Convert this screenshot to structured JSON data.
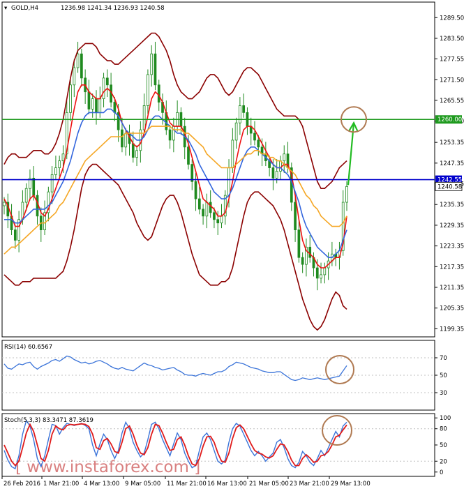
{
  "chart_data": [
    {
      "type": "candlestick",
      "title": "GOLD,H4",
      "ohlc_header": "1236.98 1241.34 1236.93 1240.58",
      "ylim": [
        1197,
        1294
      ],
      "yticks": [
        "1289.50",
        "1283.50",
        "1277.55",
        "1271.50",
        "1265.55",
        "1259.50",
        "1253.35",
        "1247.35",
        "1241.35",
        "1235.35",
        "1229.35",
        "1223.35",
        "1217.35",
        "1211.35",
        "1205.35",
        "1199.35"
      ],
      "xlabels": [
        "26 Feb 2016",
        "1 Mar 21:00",
        "4 Mar 13:00",
        "9 Mar 05:00",
        "11 Mar 21:00",
        "16 Mar 13:00",
        "21 Mar 05:00",
        "23 Mar 21:00",
        "29 Mar 13:00"
      ],
      "levels": [
        {
          "value": 1260.0,
          "label": "1260.00",
          "color": "#1e9a1e"
        },
        {
          "value": 1242.55,
          "label": "1242.55",
          "color": "#0000cc"
        }
      ],
      "last_price": {
        "value": 1240.58,
        "label": "1240.58"
      },
      "close": [
        1236,
        1232,
        1228,
        1225,
        1231,
        1236,
        1240,
        1243,
        1238,
        1232,
        1228,
        1233,
        1239,
        1244,
        1246,
        1248,
        1250,
        1262,
        1270,
        1275,
        1279,
        1272,
        1268,
        1263,
        1266,
        1262,
        1266,
        1272,
        1270,
        1265,
        1262,
        1257,
        1252,
        1256,
        1253,
        1249,
        1251,
        1257,
        1264,
        1273,
        1279,
        1270,
        1265,
        1262,
        1257,
        1254,
        1258,
        1262,
        1258,
        1252,
        1247,
        1242,
        1237,
        1234,
        1232,
        1236,
        1233,
        1231,
        1230,
        1232,
        1238,
        1246,
        1254,
        1259,
        1264,
        1262,
        1258,
        1256,
        1254,
        1252,
        1250,
        1248,
        1246,
        1243,
        1245,
        1248,
        1250,
        1246,
        1236,
        1228,
        1220,
        1218,
        1223,
        1220,
        1217,
        1214,
        1215,
        1217,
        1219,
        1221,
        1220,
        1222,
        1236,
        1240.58
      ],
      "series": [
        {
          "name": "",
          "color": "#ee1111",
          "values": [
            1237,
            1235,
            1232,
            1229,
            1229,
            1231,
            1234,
            1237,
            1238,
            1236,
            1233,
            1232,
            1234,
            1237,
            1240,
            1243,
            1246,
            1251,
            1257,
            1263,
            1268,
            1270,
            1270,
            1268,
            1267,
            1266,
            1266,
            1268,
            1269,
            1268,
            1266,
            1263,
            1259,
            1257,
            1255,
            1253,
            1252,
            1253,
            1256,
            1261,
            1266,
            1268,
            1267,
            1265,
            1262,
            1259,
            1258,
            1258,
            1258,
            1256,
            1253,
            1249,
            1245,
            1241,
            1237,
            1236,
            1235,
            1234,
            1232,
            1232,
            1233,
            1237,
            1242,
            1248,
            1253,
            1257,
            1258,
            1258,
            1257,
            1255,
            1253,
            1251,
            1249,
            1247,
            1246,
            1246,
            1247,
            1247,
            1244,
            1238,
            1231,
            1225,
            1222,
            1221,
            1220,
            1218,
            1217,
            1217,
            1218,
            1219,
            1220,
            1220,
            1224,
            1232
          ]
        },
        {
          "name": "",
          "color": "#3366dd",
          "values": [
            1231,
            1231,
            1231,
            1230,
            1230,
            1231,
            1232,
            1233,
            1234,
            1234,
            1234,
            1234,
            1235,
            1236,
            1238,
            1240,
            1242,
            1245,
            1248,
            1252,
            1256,
            1259,
            1261,
            1262,
            1262,
            1262,
            1262,
            1262,
            1263,
            1263,
            1262,
            1261,
            1259,
            1257,
            1256,
            1255,
            1254,
            1254,
            1255,
            1257,
            1260,
            1261,
            1261,
            1260,
            1259,
            1258,
            1257,
            1256,
            1256,
            1255,
            1254,
            1252,
            1250,
            1247,
            1245,
            1243,
            1241,
            1239,
            1238,
            1237,
            1237,
            1238,
            1240,
            1243,
            1246,
            1249,
            1251,
            1252,
            1252,
            1251,
            1250,
            1249,
            1248,
            1247,
            1246,
            1246,
            1245,
            1244,
            1242,
            1239,
            1236,
            1232,
            1229,
            1227,
            1225,
            1223,
            1222,
            1221,
            1220,
            1220,
            1221,
            1222,
            1225,
            1228
          ]
        },
        {
          "name": "",
          "color": "#f5a623",
          "values": [
            1221,
            1222,
            1223,
            1223,
            1224,
            1225,
            1226,
            1227,
            1228,
            1229,
            1230,
            1230,
            1231,
            1232,
            1233,
            1235,
            1236,
            1238,
            1240,
            1242,
            1244,
            1246,
            1248,
            1249,
            1250,
            1251,
            1252,
            1253,
            1254,
            1255,
            1255,
            1255,
            1255,
            1256,
            1256,
            1256,
            1256,
            1256,
            1256,
            1257,
            1258,
            1258,
            1258,
            1258,
            1258,
            1258,
            1257,
            1257,
            1257,
            1256,
            1256,
            1255,
            1254,
            1253,
            1252,
            1250,
            1249,
            1248,
            1247,
            1246,
            1246,
            1246,
            1246,
            1247,
            1248,
            1249,
            1250,
            1250,
            1251,
            1251,
            1250,
            1250,
            1249,
            1249,
            1248,
            1248,
            1247,
            1246,
            1245,
            1244,
            1242,
            1240,
            1238,
            1237,
            1235,
            1234,
            1232,
            1231,
            1230,
            1229,
            1229,
            1229,
            1230,
            1232
          ]
        },
        {
          "name": "",
          "color": "#8b0000",
          "values": [
            1247,
            1249,
            1250,
            1250,
            1249,
            1249,
            1249,
            1250,
            1251,
            1251,
            1251,
            1250,
            1250,
            1251,
            1253,
            1256,
            1260,
            1266,
            1272,
            1277,
            1280,
            1281,
            1282,
            1282,
            1282,
            1281,
            1279,
            1278,
            1277,
            1277,
            1276,
            1276,
            1277,
            1278,
            1279,
            1280,
            1281,
            1282,
            1283,
            1284,
            1285,
            1285,
            1284,
            1282,
            1280,
            1277,
            1273,
            1270,
            1268,
            1267,
            1266,
            1266,
            1267,
            1268,
            1270,
            1272,
            1273,
            1273,
            1272,
            1270,
            1268,
            1267,
            1268,
            1270,
            1272,
            1274,
            1275,
            1275,
            1274,
            1273,
            1271,
            1269,
            1267,
            1265,
            1263,
            1262,
            1261,
            1261,
            1261,
            1261,
            1260,
            1258,
            1254,
            1250,
            1246,
            1242,
            1240,
            1240,
            1241,
            1242,
            1244,
            1246,
            1247,
            1248
          ]
        },
        {
          "name": "",
          "color": "#8b0000",
          "values": [
            1215,
            1214,
            1213,
            1212,
            1212,
            1213,
            1213,
            1213,
            1214,
            1214,
            1214,
            1214,
            1214,
            1214,
            1214,
            1215,
            1216,
            1219,
            1223,
            1228,
            1234,
            1240,
            1244,
            1246,
            1247,
            1247,
            1246,
            1245,
            1244,
            1243,
            1242,
            1241,
            1239,
            1237,
            1235,
            1233,
            1230,
            1228,
            1226,
            1225,
            1226,
            1229,
            1232,
            1235,
            1237,
            1238,
            1238,
            1236,
            1233,
            1229,
            1225,
            1221,
            1218,
            1215,
            1214,
            1213,
            1212,
            1212,
            1212,
            1213,
            1213,
            1214,
            1217,
            1222,
            1227,
            1232,
            1236,
            1238,
            1239,
            1239,
            1238,
            1237,
            1236,
            1235,
            1233,
            1231,
            1228,
            1224,
            1220,
            1216,
            1212,
            1208,
            1205,
            1202,
            1200,
            1199,
            1200,
            1202,
            1205,
            1208,
            1210,
            1209,
            1206,
            1205
          ]
        }
      ]
    },
    {
      "type": "line",
      "title": "RSI(14) 60.6567",
      "ylim": [
        10,
        90
      ],
      "yticks": [
        "70",
        "50",
        "30"
      ],
      "series": [
        {
          "name": "RSI(14)",
          "color": "#3b74d9",
          "values": [
            63,
            58,
            57,
            60,
            63,
            62,
            64,
            65,
            60,
            57,
            60,
            62,
            64,
            67,
            68,
            66,
            69,
            72,
            71,
            68,
            66,
            64,
            65,
            63,
            64,
            66,
            67,
            65,
            63,
            60,
            58,
            57,
            59,
            57,
            56,
            55,
            58,
            61,
            64,
            62,
            61,
            59,
            58,
            56,
            57,
            58,
            59,
            56,
            54,
            51,
            50,
            50,
            49,
            51,
            52,
            51,
            50,
            52,
            54,
            54,
            56,
            60,
            62,
            65,
            64,
            63,
            61,
            59,
            58,
            57,
            55,
            54,
            53,
            53,
            54,
            54,
            51,
            48,
            45,
            44,
            45,
            47,
            46,
            45,
            46,
            47,
            46,
            45,
            46,
            47,
            48,
            49,
            55,
            61
          ]
        }
      ]
    },
    {
      "type": "line",
      "title": "Stoch(5,3,3) 83.3471 87.3619",
      "ylim": [
        -8,
        108
      ],
      "yticks": [
        "100",
        "80",
        "50",
        "20",
        "0"
      ],
      "series": [
        {
          "name": "%K",
          "color": "#3b74d9",
          "values": [
            40,
            22,
            10,
            6,
            30,
            70,
            95,
            85,
            60,
            25,
            10,
            30,
            60,
            88,
            86,
            70,
            82,
            90,
            88,
            86,
            88,
            90,
            86,
            80,
            50,
            30,
            52,
            70,
            60,
            40,
            25,
            40,
            72,
            92,
            80,
            55,
            40,
            28,
            35,
            60,
            88,
            92,
            80,
            60,
            45,
            30,
            52,
            72,
            60,
            35,
            20,
            8,
            12,
            40,
            65,
            72,
            60,
            40,
            20,
            15,
            22,
            55,
            80,
            90,
            85,
            70,
            55,
            40,
            30,
            38,
            30,
            20,
            28,
            35,
            55,
            60,
            45,
            25,
            12,
            8,
            18,
            38,
            30,
            18,
            12,
            25,
            40,
            30,
            45,
            60,
            75,
            65,
            85,
            92
          ]
        },
        {
          "name": "%D",
          "color": "#e01b1b",
          "values": [
            50,
            35,
            20,
            12,
            20,
            45,
            72,
            88,
            75,
            50,
            25,
            20,
            40,
            70,
            85,
            80,
            78,
            86,
            88,
            87,
            88,
            89,
            88,
            84,
            70,
            45,
            42,
            58,
            62,
            52,
            38,
            35,
            55,
            80,
            85,
            70,
            50,
            35,
            32,
            45,
            70,
            88,
            86,
            72,
            55,
            40,
            42,
            60,
            65,
            50,
            30,
            15,
            12,
            25,
            48,
            65,
            66,
            55,
            35,
            20,
            18,
            35,
            62,
            82,
            87,
            80,
            66,
            52,
            40,
            35,
            33,
            28,
            26,
            30,
            42,
            52,
            50,
            38,
            22,
            12,
            12,
            25,
            32,
            26,
            18,
            20,
            30,
            32,
            38,
            50,
            65,
            68,
            78,
            87
          ]
        }
      ]
    }
  ],
  "watermark": "[ www.instaforex.com ]"
}
